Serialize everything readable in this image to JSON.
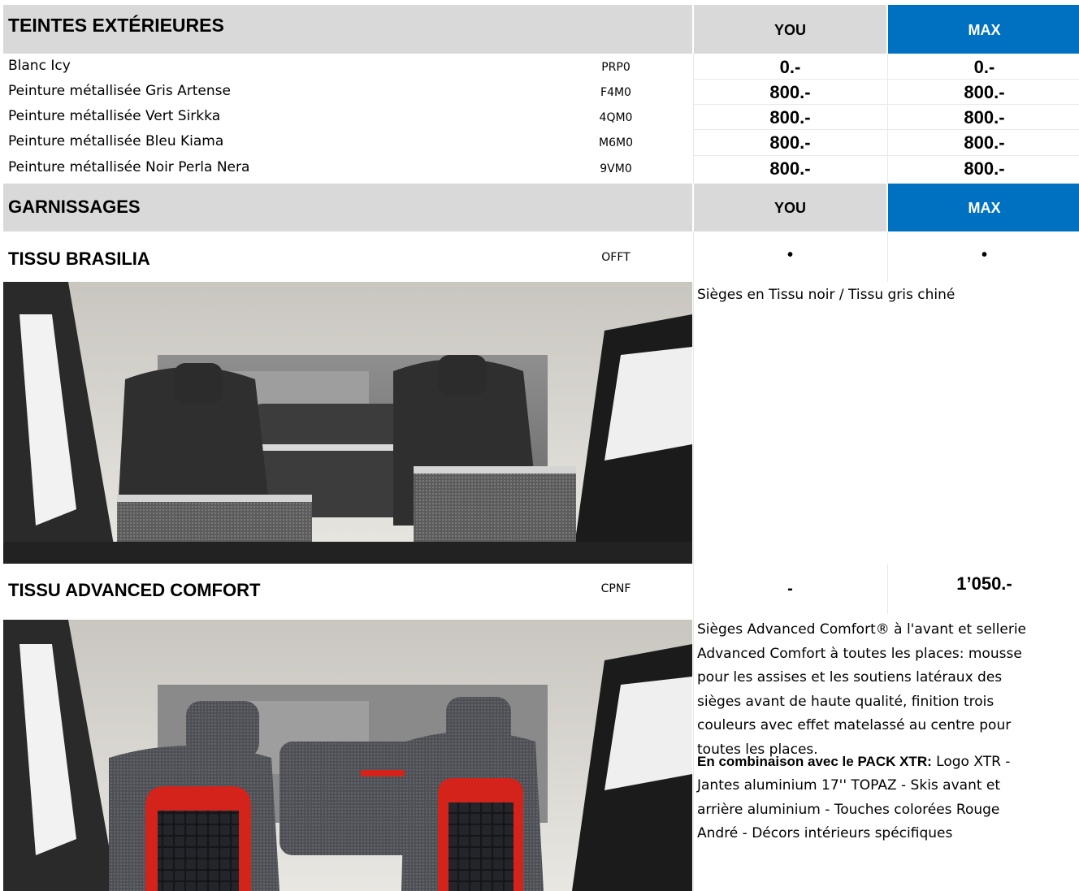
{
  "exterior": {
    "title": "TEINTES EXTÉRIEURES",
    "col_you": "YOU",
    "col_max": "MAX",
    "rows": [
      {
        "label": "Blanc Icy",
        "code": "PRP0",
        "you": "0.-",
        "max": "0.-"
      },
      {
        "label": "Peinture métallisée Gris Artense",
        "code": "F4M0",
        "you": "800.-",
        "max": "800.-"
      },
      {
        "label": "Peinture métallisée Vert Sirkka",
        "code": "4QM0",
        "you": "800.-",
        "max": "800.-"
      },
      {
        "label": "Peinture métallisée Bleu Kiama",
        "code": "M6M0",
        "you": "800.-",
        "max": "800.-"
      },
      {
        "label": "Peinture métallisée Noir Perla Nera",
        "code": "9VM0",
        "you": "800.-",
        "max": "800.-"
      }
    ]
  },
  "upholstery": {
    "title": "GARNISSAGES",
    "col_you": "YOU",
    "col_max": "MAX",
    "items": [
      {
        "name": "TISSU BRASILIA",
        "code": "OFFT",
        "you": "•",
        "max": "•",
        "description": "Sièges en Tissu noir / Tissu gris chiné"
      },
      {
        "name": "TISSU ADVANCED COMFORT",
        "code": "CPNF",
        "you": "-",
        "max": "1’050.-",
        "description_lines": [
          "Sièges Advanced Comfort® à l'avant et sellerie",
          "Advanced Comfort à toutes les places: mousse",
          "pour les assises et les soutiens latéraux des",
          "sièges avant de haute qualité, finition trois",
          "couleurs avec effet matelassé au centre pour",
          "toutes les places."
        ],
        "combo_label": "En combinaison avec le PACK XTR:",
        "combo_lines": [
          "Logo XTR -",
          "Jantes aluminium 17'' TOPAZ - Skis avant et",
          "arrière aluminium - Touches colorées Rouge",
          "André - Décors intérieurs spécifiques"
        ]
      }
    ]
  },
  "colors": {
    "header_gray": "#d9d9d9",
    "header_max": "#0070c0",
    "seat_accent": "#d4231b"
  }
}
